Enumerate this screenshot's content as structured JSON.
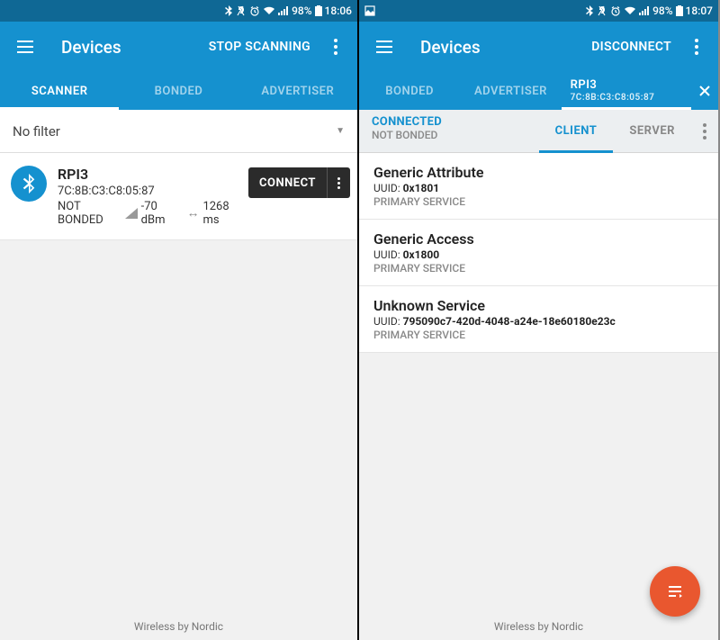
{
  "left": {
    "status": {
      "battery": "98%",
      "time": "18:06"
    },
    "app_title": "Devices",
    "action": "STOP SCANNING",
    "tabs": [
      "SCANNER",
      "BONDED",
      "ADVERTISER"
    ],
    "filter": "No filter",
    "device": {
      "name": "RPI3",
      "mac": "7C:8B:C3:C8:05:87",
      "bond": "NOT BONDED",
      "rssi": "-70 dBm",
      "interval": "1268 ms",
      "connect": "CONNECT"
    },
    "footer": "Wireless by Nordic"
  },
  "right": {
    "status": {
      "battery": "98%",
      "time": "18:07"
    },
    "app_title": "Devices",
    "action": "DISCONNECT",
    "tabs": [
      "BONDED",
      "ADVERTISER"
    ],
    "dev_tab": {
      "name": "RPI3",
      "mac": "7C:8B:C3:C8:05:87"
    },
    "conn": {
      "status": "CONNECTED",
      "bond": "NOT BONDED"
    },
    "subtabs": [
      "CLIENT",
      "SERVER"
    ],
    "services": [
      {
        "name": "Generic Attribute",
        "uuid_label": "UUID: ",
        "uuid": "0x1801",
        "type": "PRIMARY SERVICE"
      },
      {
        "name": "Generic Access",
        "uuid_label": "UUID: ",
        "uuid": "0x1800",
        "type": "PRIMARY SERVICE"
      },
      {
        "name": "Unknown Service",
        "uuid_label": "UUID: ",
        "uuid": "795090c7-420d-4048-a24e-18e60180e23c",
        "type": "PRIMARY SERVICE"
      }
    ],
    "footer": "Wireless by Nordic"
  }
}
